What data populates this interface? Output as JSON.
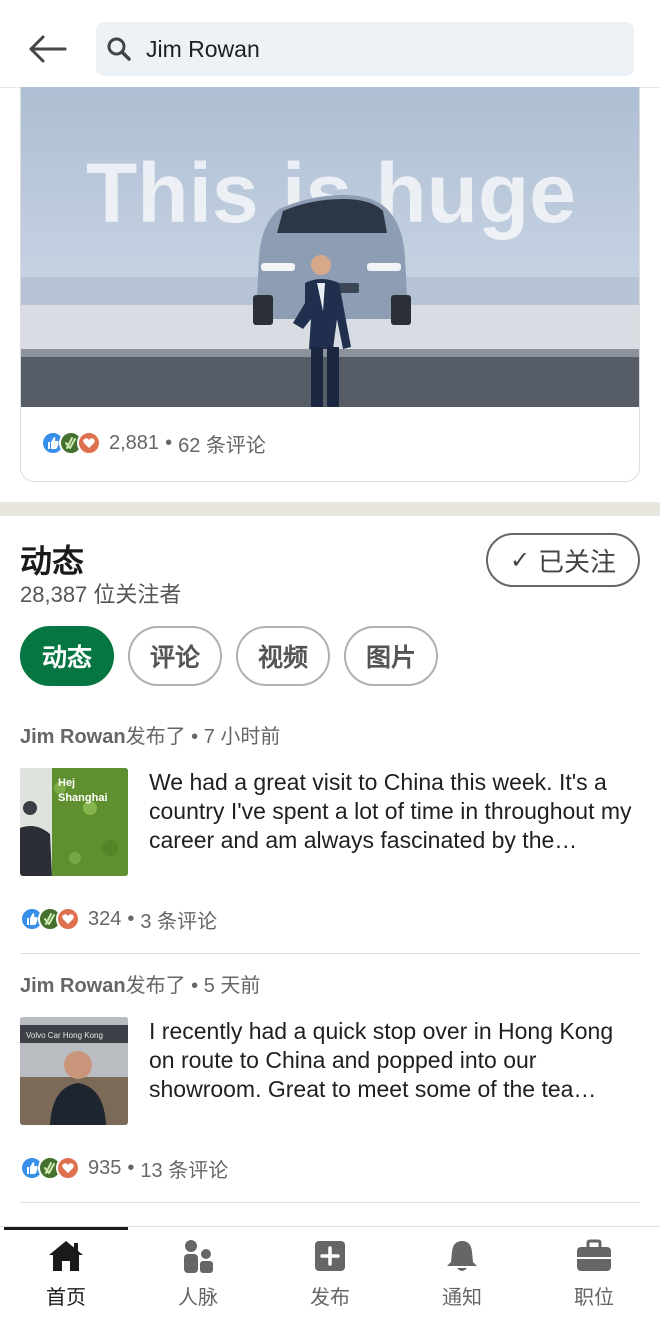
{
  "search": {
    "value": "Jim Rowan"
  },
  "feature": {
    "headline": "This is huge",
    "reaction_count": "2,881",
    "dot": "•",
    "comments": "62 条评论"
  },
  "activity": {
    "title": "动态",
    "followers": "28,387 位关注者",
    "follow_check": "✓",
    "follow_label": "已关注",
    "filters": [
      {
        "label": "动态",
        "active": true
      },
      {
        "label": "评论",
        "active": false
      },
      {
        "label": "视频",
        "active": false
      },
      {
        "label": "图片",
        "active": false
      }
    ]
  },
  "posts": [
    {
      "author": "Jim Rowan",
      "action": "发布了",
      "dot": "•",
      "time": "7 小时前",
      "thumb_text": "Hej\nShanghai",
      "text": "We had a great visit to China this week. It's a country I've spent a lot of time in throughout my career and am always fascinated by the…",
      "reaction_count": "324",
      "comments": "3 条评论"
    },
    {
      "author": "Jim Rowan",
      "action": "发布了",
      "dot": "•",
      "time": "5 天前",
      "thumb_text": "Volvo Car Hong Kong",
      "text": "I recently had a quick stop over in Hong Kong on route to China and popped into our showroom. Great to meet some of the tea…",
      "reaction_count": "935",
      "comments": "13 条评论"
    }
  ],
  "nav": [
    {
      "label": "首页",
      "icon": "home-icon",
      "active": true
    },
    {
      "label": "人脉",
      "icon": "network-icon",
      "active": false
    },
    {
      "label": "发布",
      "icon": "post-plus-icon",
      "active": false
    },
    {
      "label": "通知",
      "icon": "bell-icon",
      "active": false
    },
    {
      "label": "职位",
      "icon": "briefcase-icon",
      "active": false
    }
  ],
  "colors": {
    "brand_green": "#057642",
    "like_blue": "#378fe9",
    "love_orange": "#df704d",
    "clap_green": "#44712e"
  }
}
